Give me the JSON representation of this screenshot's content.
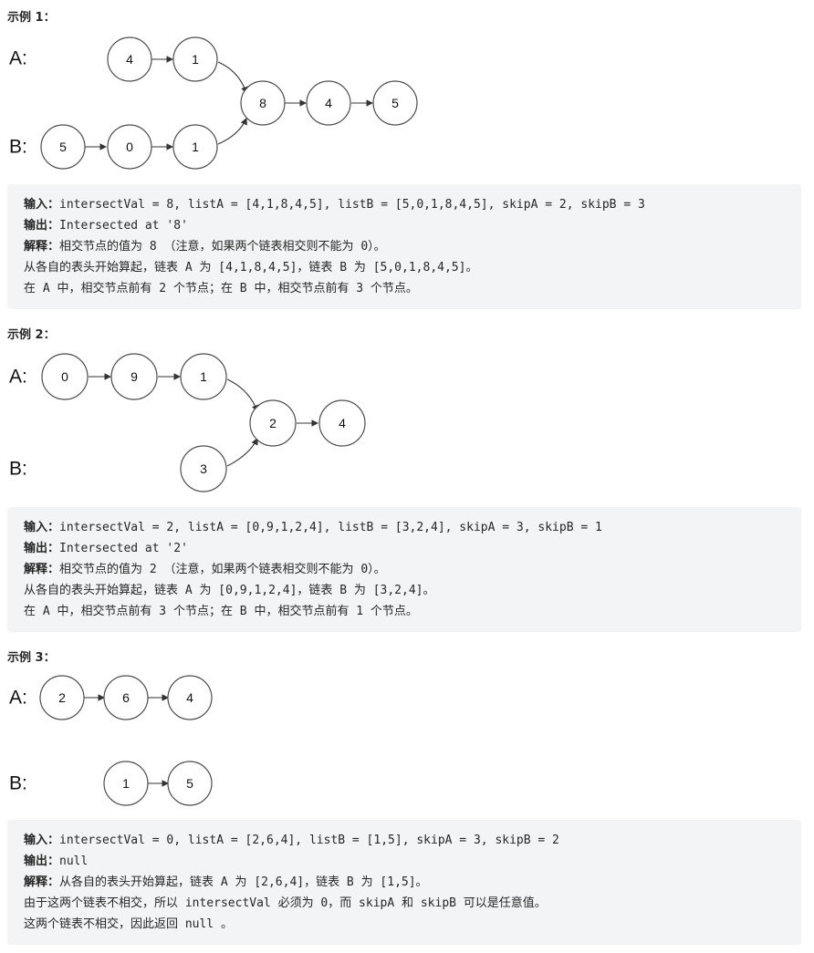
{
  "examples": [
    {
      "heading": "示例 1：",
      "list_a_label": "A:",
      "list_b_label": "B:",
      "nodes_a": [
        "4",
        "1"
      ],
      "nodes_b": [
        "5",
        "0",
        "1"
      ],
      "nodes_shared": [
        "8",
        "4",
        "5"
      ],
      "input_label": "输入：",
      "input_text": "intersectVal = 8, listA = [4,1,8,4,5], listB = [5,0,1,8,4,5], skipA = 2, skipB = 3",
      "output_label": "输出：",
      "output_text": "Intersected at '8'",
      "explain_label": "解释：",
      "explain_lines": [
        "相交节点的值为 8 （注意，如果两个链表相交则不能为 0）。",
        "从各自的表头开始算起，链表 A 为 [4,1,8,4,5]，链表 B 为 [5,0,1,8,4,5]。",
        "在 A 中，相交节点前有 2 个节点；在 B 中，相交节点前有 3 个节点。"
      ]
    },
    {
      "heading": "示例 2：",
      "list_a_label": "A:",
      "list_b_label": "B:",
      "nodes_a": [
        "0",
        "9",
        "1"
      ],
      "nodes_b": [
        "3"
      ],
      "nodes_shared": [
        "2",
        "4"
      ],
      "input_label": "输入：",
      "input_text": "intersectVal = 2, listA = [0,9,1,2,4], listB = [3,2,4], skipA = 3, skipB = 1",
      "output_label": "输出：",
      "output_text": "Intersected at '2'",
      "explain_label": "解释：",
      "explain_lines": [
        "相交节点的值为 2 （注意，如果两个链表相交则不能为 0）。",
        "从各自的表头开始算起，链表 A 为 [0,9,1,2,4]，链表 B 为 [3,2,4]。",
        "在 A 中，相交节点前有 3 个节点；在 B 中，相交节点前有 1 个节点。"
      ]
    },
    {
      "heading": "示例 3：",
      "list_a_label": "A:",
      "list_b_label": "B:",
      "nodes_a": [
        "2",
        "6",
        "4"
      ],
      "nodes_b": [
        "1",
        "5"
      ],
      "nodes_shared": [],
      "input_label": "输入：",
      "input_text": "intersectVal = 0, listA = [2,6,4], listB = [1,5], skipA = 3, skipB = 2",
      "output_label": "输出：",
      "output_text": "null",
      "explain_label": "解释：",
      "explain_lines": [
        "从各自的表头开始算起，链表 A 为 [2,6,4]，链表 B 为 [1,5]。",
        "由于这两个链表不相交，所以 intersectVal 必须为 0，而 skipA 和 skipB 可以是任意值。",
        "这两个链表不相交，因此返回 null 。"
      ]
    }
  ]
}
